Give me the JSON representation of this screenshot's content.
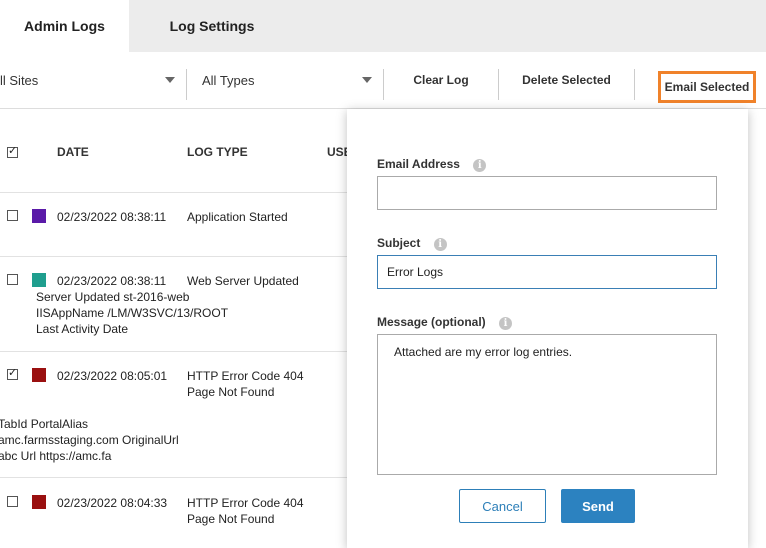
{
  "tabs": [
    {
      "label": "Admin Logs",
      "active": true
    },
    {
      "label": "Log Settings",
      "active": false
    }
  ],
  "toolbar": {
    "sites_select": "ll Sites",
    "types_select": "All Types",
    "clear_log": "Clear Log",
    "delete_selected": "Delete Selected",
    "email_selected": "Email Selected"
  },
  "table": {
    "headers": {
      "date": "DATE",
      "log_type": "LOG TYPE",
      "user": "USE"
    },
    "rows": [
      {
        "date": "02/23/2022 08:38:11",
        "type": "Application Started",
        "color": "#5a1aa8",
        "checked": false
      },
      {
        "date": "02/23/2022 08:38:11",
        "type": "Web Server Updated",
        "color": "#1f9e8e",
        "checked": false,
        "details": [
          "Server Updated st-2016-web",
          "IISAppName /LM/W3SVC/13/ROOT",
          "Last Activity Date"
        ]
      },
      {
        "date": "02/23/2022 08:05:01",
        "type_line1": "HTTP Error Code 404",
        "type_line2": "Page Not Found",
        "color": "#9a1010",
        "checked": true,
        "details": [
          "TabId PortalAlias",
          "amc.farmsstaging.com OriginalUrl",
          "abc Url https://amc.fa"
        ]
      },
      {
        "date": "02/23/2022 08:04:33",
        "type_line1": "HTTP Error Code 404",
        "type_line2": "Page Not Found",
        "color": "#9a1010",
        "checked": false
      }
    ]
  },
  "email_form": {
    "email_label": "Email Address",
    "email_value": "",
    "subject_label": "Subject",
    "subject_value": "Error Logs",
    "message_label": "Message (optional)",
    "message_value": "Attached are my error log entries.",
    "cancel": "Cancel",
    "send": "Send"
  },
  "colors": {
    "accent": "#2c82c0",
    "highlight": "#f0822a"
  }
}
